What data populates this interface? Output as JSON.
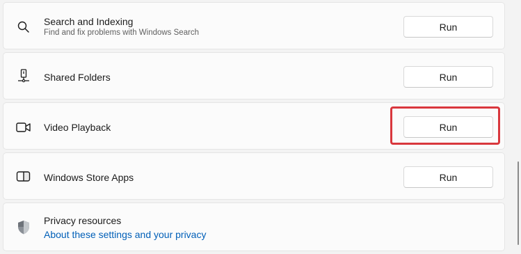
{
  "troubleshooters": [
    {
      "title": "Search and Indexing",
      "subtitle": "Find and fix problems with Windows Search",
      "icon": "search-icon",
      "button": "Run"
    },
    {
      "title": "Shared Folders",
      "icon": "shared-folder-icon",
      "button": "Run"
    },
    {
      "title": "Video Playback",
      "icon": "video-camera-icon",
      "button": "Run",
      "highlighted": true,
      "highlight_color": "#d9373d"
    },
    {
      "title": "Windows Store Apps",
      "icon": "store-apps-icon",
      "button": "Run"
    }
  ],
  "privacy": {
    "title": "Privacy resources",
    "link": "About these settings and your privacy",
    "icon": "shield-icon",
    "link_color": "#005fb8"
  }
}
